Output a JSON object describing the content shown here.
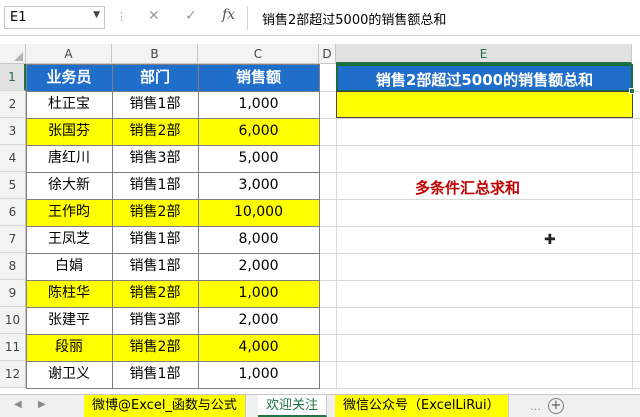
{
  "formula_bar": {
    "name_box": "E1",
    "formula": "销售2部超过5000的销售额总和",
    "cancel_glyph": "✕",
    "enter_glyph": "✓",
    "fx_label": "fx"
  },
  "columns": [
    "A",
    "B",
    "C",
    "D",
    "E"
  ],
  "rows": [
    "1",
    "2",
    "3",
    "4",
    "5",
    "6",
    "7",
    "8",
    "9",
    "10",
    "11",
    "12"
  ],
  "table": {
    "headers": [
      "业务员",
      "部门",
      "销售额"
    ],
    "data": [
      {
        "name": "杜正宝",
        "dept": "销售1部",
        "sales": "1,000",
        "highlight": false
      },
      {
        "name": "张国芬",
        "dept": "销售2部",
        "sales": "6,000",
        "highlight": true
      },
      {
        "name": "唐红川",
        "dept": "销售3部",
        "sales": "5,000",
        "highlight": false
      },
      {
        "name": "徐大新",
        "dept": "销售1部",
        "sales": "3,000",
        "highlight": false
      },
      {
        "name": "王作昀",
        "dept": "销售2部",
        "sales": "10,000",
        "highlight": true
      },
      {
        "name": "王凤芝",
        "dept": "销售1部",
        "sales": "8,000",
        "highlight": false
      },
      {
        "name": "白娟",
        "dept": "销售1部",
        "sales": "2,000",
        "highlight": false
      },
      {
        "name": "陈柱华",
        "dept": "销售2部",
        "sales": "1,000",
        "highlight": true
      },
      {
        "name": "张建平",
        "dept": "销售3部",
        "sales": "2,000",
        "highlight": false
      },
      {
        "name": "段丽",
        "dept": "销售2部",
        "sales": "4,000",
        "highlight": true
      },
      {
        "name": "谢卫义",
        "dept": "销售1部",
        "sales": "1,000",
        "highlight": false
      }
    ]
  },
  "result": {
    "header": "销售2部超过5000的销售额总和",
    "value": ""
  },
  "note": "多条件汇总求和",
  "sheet_tabs": [
    {
      "label": "微博@Excel_函数与公式",
      "style": "yellow"
    },
    {
      "label": "欢迎关注",
      "style": "active"
    },
    {
      "label": "微信公众号（ExcelLiRui）",
      "style": "yellow"
    }
  ],
  "colors": {
    "header_blue": "#1f6ec9",
    "highlight_yellow": "#ffff00",
    "note_red": "#c00000",
    "excel_green": "#217346"
  }
}
